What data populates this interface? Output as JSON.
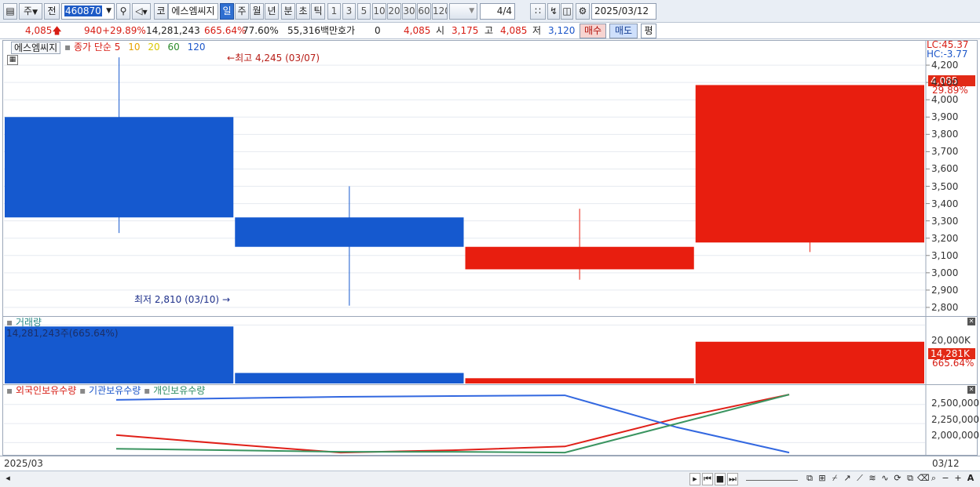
{
  "toolbar": {
    "period_selector": "주",
    "prev_label": "전",
    "stock_code": "460870",
    "kor_label": "코",
    "stock_name": "에스엠씨지",
    "period_tabs": [
      "일",
      "주",
      "월",
      "년",
      "분",
      "초",
      "틱"
    ],
    "active_period": "일",
    "interval_buttons": [
      "1",
      "3",
      "5",
      "10",
      "20",
      "30",
      "60",
      "120"
    ],
    "page_counter": "4/4",
    "date": "2025/03/12"
  },
  "quote": {
    "price": "4,085",
    "change": "940",
    "change_pct": "+29.89%",
    "volume": "14,281,243",
    "volume_pct": "665.64%",
    "turnover_pct": "77.60%",
    "amount": "55,316백만",
    "hoga_label": "호가",
    "hoga_value": "0",
    "hoga_price": "4,085",
    "open_label": "시",
    "open_value": "3,175",
    "high_label": "고",
    "high_value": "4,085",
    "low_label": "저",
    "low_value": "3,120",
    "buy_label": "매수",
    "sell_label": "매도",
    "avg_label": "평"
  },
  "price_panel": {
    "legend_name": "에스엠씨지",
    "legend_ma_label": "종가 단순",
    "legend_ma": [
      "5",
      "10",
      "20",
      "60",
      "120"
    ],
    "ma_colors": [
      "#d71d14",
      "#e6a200",
      "#e8d400",
      "#2a8a2a",
      "#1c56c9"
    ],
    "high_note": "최고 4,245 (03/07)",
    "low_note": "최저 2,810 (03/10)",
    "lc_label": "LC:45.37",
    "hc_label": "HC:-3.77",
    "last_price_tag": "4,085",
    "last_pct_tag": "29.89%",
    "up_color": "#e81e0f",
    "down_color": "#1559cf"
  },
  "volume_panel": {
    "title": "거래량",
    "value_text": "14,281,243주(665.64%)",
    "axis_tick": "20,000K",
    "last_tag": "14,281K",
    "last_pct": "665.64%"
  },
  "holding_panel": {
    "legend": [
      "외국인보유수량",
      "기관보유수량",
      "개인보유수량"
    ],
    "colors": [
      "#e02019",
      "#3368e0",
      "#3a9460"
    ],
    "ticks": [
      "2,500,000",
      "2,250,000",
      "2,000,000"
    ]
  },
  "datebar": {
    "left_date": "2025/03",
    "right_date": "03/12"
  },
  "chart_data": [
    {
      "type": "candlestick",
      "title": "에스엠씨지",
      "y_ticks": [
        4200,
        4100,
        4000,
        3900,
        3800,
        3700,
        3600,
        3500,
        3400,
        3300,
        3200,
        3100,
        3000,
        2900,
        2800
      ],
      "ylim": [
        2750,
        4300
      ],
      "candles": [
        {
          "open": 3900,
          "high": 4245,
          "low": 3230,
          "close": 3320
        },
        {
          "open": 3320,
          "high": 3500,
          "low": 2810,
          "close": 3150
        },
        {
          "open": 3020,
          "high": 3370,
          "low": 2960,
          "close": 3150
        },
        {
          "open": 3175,
          "high": 4085,
          "low": 3120,
          "close": 4085
        }
      ]
    },
    {
      "type": "bar",
      "title": "거래량",
      "values": [
        19500000,
        3600000,
        1800000,
        14281243
      ],
      "colors": [
        "#1559cf",
        "#1559cf",
        "#e81e0f",
        "#e81e0f"
      ],
      "ylim": [
        0,
        22000000
      ]
    },
    {
      "type": "line",
      "ylim": [
        1850000,
        2600000
      ],
      "series": [
        {
          "name": "외국인보유수량",
          "values": [
            2100000,
            1980000,
            1870000,
            1900000,
            1950000,
            2320000,
            2630000
          ]
        },
        {
          "name": "기관보유수량",
          "values": [
            2560000,
            2580000,
            2600000,
            2610000,
            2620000,
            2200000,
            1870000
          ]
        },
        {
          "name": "개인보유수량",
          "values": [
            1920000,
            1900000,
            1880000,
            1880000,
            1870000,
            2250000,
            2630000
          ]
        }
      ]
    }
  ]
}
